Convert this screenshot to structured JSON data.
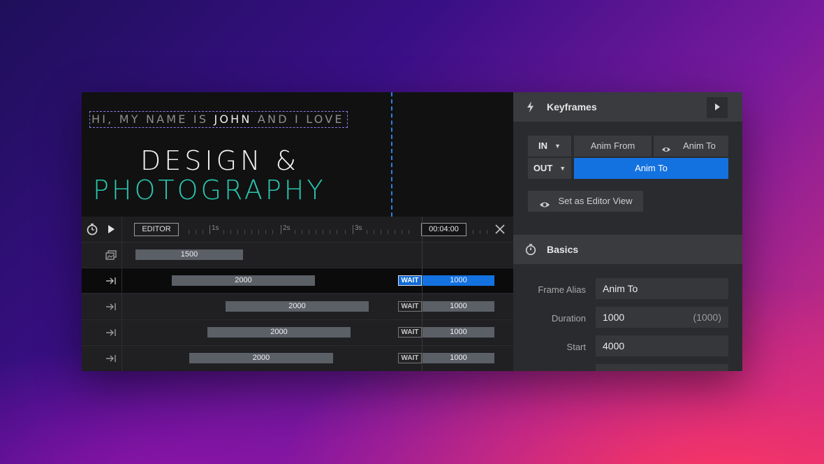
{
  "stage": {
    "intro_pre": "HI, MY NAME IS ",
    "intro_name": "JOHN",
    "intro_post": " AND I LOVE",
    "headline_1": "DESIGN &",
    "headline_2": "PHOTOGRAPHY",
    "headline_2_color": "#2bc7b0",
    "guide_color": "#2e7fe0"
  },
  "timeline": {
    "editor_label": "EDITOR",
    "time_display": "00:04:00",
    "ticks": [
      "1s",
      "2s",
      "3s"
    ],
    "icons": {
      "timer": "stopwatch-icon",
      "play": "play-icon",
      "close": "close-icon"
    },
    "rows": [
      {
        "icon": "image-layers-icon",
        "bar": "1500"
      },
      {
        "icon": "arrow-in-icon",
        "bar": "2000",
        "wait": "WAIT",
        "after": "1000",
        "active": true
      },
      {
        "icon": "arrow-in-icon",
        "bar": "2000",
        "wait": "WAIT",
        "after": "1000"
      },
      {
        "icon": "arrow-in-icon",
        "bar": "2000",
        "wait": "WAIT",
        "after": "1000"
      },
      {
        "icon": "arrow-in-icon",
        "bar": "2000",
        "wait": "WAIT",
        "after": "1000"
      }
    ],
    "accent": "#1472e0"
  },
  "panel": {
    "keyframes_title": "Keyframes",
    "in_label": "IN",
    "out_label": "OUT",
    "anim_from": "Anim From",
    "anim_to_top": "Anim To",
    "anim_to_selected": "Anim To",
    "set_editor_view": "Set as Editor View",
    "basics_title": "Basics",
    "fields": {
      "frame_alias_label": "Frame Alias",
      "frame_alias_value": "Anim To",
      "duration_label": "Duration",
      "duration_value": "1000",
      "duration_default": "(1000)",
      "start_label": "Start",
      "start_value": "4000"
    }
  }
}
